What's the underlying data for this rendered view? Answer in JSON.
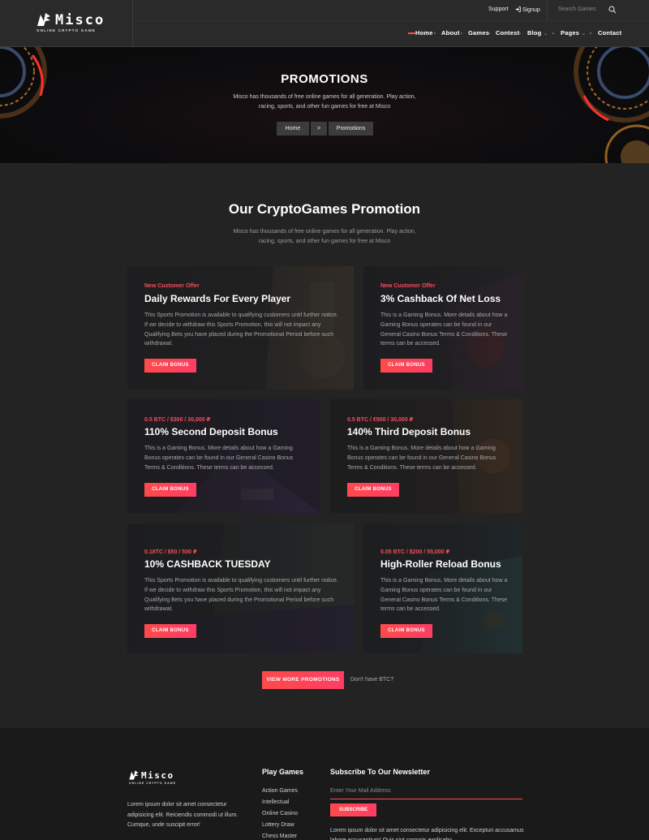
{
  "header": {
    "brand": "Misco",
    "tagline": "ONLINE CRYPTO GAME",
    "support": "Support",
    "signup": "Signup",
    "search_placeholder": "Search Games",
    "nav": [
      "Home",
      "About",
      "Games",
      "Contest",
      "Blog",
      "Pages",
      "Contact"
    ]
  },
  "hero": {
    "title": "PROMOTIONS",
    "subtitle": "Misco has thousands of free online games for all generation. Play action, racing, sports, and other fun games for free at Misco",
    "breadcrumb": [
      "Home",
      ">",
      "Promotions"
    ]
  },
  "section": {
    "title": "Our CryptoGames Promotion",
    "subtitle": "Misco has thousands of free online games for all generation. Play action, racing, sports, and other fun games for free at Misco"
  },
  "cards": [
    {
      "kicker": "New Customer Offer",
      "title": "Daily Rewards For Every Player",
      "text": "This Sports Promotion is available to qualifying customers until further notice. If we decide to withdraw this Sports Promotion, this will not impact any Qualifying Bets you have placed during the Promotional Period before such withdrawal.",
      "button": "CLAIM BONUS"
    },
    {
      "kicker": "New Customer Offer",
      "title": "3% Cashback Of Net Loss",
      "text": "This is a Gaming Bonus. More details about how a Gaming Bonus operates can be found in our General Casino Bonus Terms & Conditions. These terms can be accessed.",
      "button": "CLAIM BONUS"
    },
    {
      "kicker": "0.5 BTC / $300 / 30,000 ₽",
      "title": "110% Second Deposit Bonus",
      "text": "This is a Gaming Bonus. More details about how a Gaming Bonus operates can be found in our General Casino Bonus Terms & Conditions. These terms can be accessed.",
      "button": "CLAIM BONUS"
    },
    {
      "kicker": "0.5 BTC / €500 / 30,000 ₽",
      "title": "140% Third Deposit Bonus",
      "text": "This is a Gaming Bonus. More details about how a Gaming Bonus operates can be found in our General Casino Bonus Terms & Conditions. These terms can be accessed.",
      "button": "CLAIM BONUS"
    },
    {
      "kicker": "0.18TC / $50 / 500 ₽",
      "title": "10% CASHBACK TUESDAY",
      "text": "This Sports Promotion is available to qualifying customers until further notice. If we decide to withdraw this Sports Promotion, this will not impact any Qualifying Bets you have placed during the Promotional Period before such withdrawal.",
      "button": "CLAIM BONUS"
    },
    {
      "kicker": "5.05 BTC / $200 / 55,000 ₽",
      "title": "High-Roller Reload Bonus",
      "text": "This is a Gaming Bonus. More details about how a Gaming Bonus operates can be found in our General Casino Bonus Terms & Conditions. These terms can be accessed.",
      "button": "CLAIM BONUS"
    }
  ],
  "more": {
    "button": "VIEW MORE PROMOTIONS",
    "note": "Don't have BTC?"
  },
  "footer": {
    "about": "Lorem ipsum dolor sit amet consectetur adipisicing elit. Reiciendis commodi ut illum. Cumque, unde suscipit error!",
    "games_title": "Play Games",
    "games": [
      "Action Games",
      "Intellectual",
      "Online Casino",
      "Lottery Draw",
      "Chess Master"
    ],
    "newsletter_title": "Subscribe To Our Newsletter",
    "email_placeholder": "Enter Your Mail Address",
    "subscribe": "SUBSCRIBE",
    "newsletter_text": "Lorem ipsum dolor sit amet consectetur adipisicing elit. Excepturi accusamus labore accusantium! Quis sint corporis explicabo"
  },
  "colors": {
    "accent": "#ff4a57",
    "bg": "#232323",
    "card": "#2c2c2e",
    "footer": "#1a1a1a"
  }
}
